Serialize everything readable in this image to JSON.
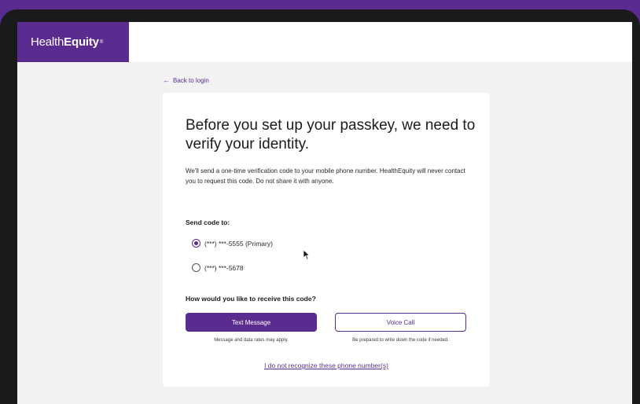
{
  "brand": {
    "name_regular": "Health",
    "name_bold": "Equity",
    "trademark": "®",
    "color": "#5b2c8f"
  },
  "nav": {
    "back_arrow_icon": "arrow-left",
    "back_label": "Back to login"
  },
  "card": {
    "title": "Before you set up your passkey, we need to verify your identity.",
    "description": "We'll send a one-time verification code to your mobile phone number. HealthEquity will never contact you to request this code. Do not share it with anyone.",
    "send_code_label": "Send code to:",
    "phone_options": [
      {
        "label": "(***) ***-5555 (Primary)",
        "selected": true
      },
      {
        "label": "(***) ***-5678",
        "selected": false
      }
    ],
    "receive_label": "How would you like to receive this code?",
    "text_button": "Text Message",
    "voice_button": "Voice Call",
    "text_note": "Message and data rates may apply.",
    "voice_note": "Be prepared to write down the code if needed.",
    "unrecognized_link": "I do not recognize these phone number(s)"
  }
}
